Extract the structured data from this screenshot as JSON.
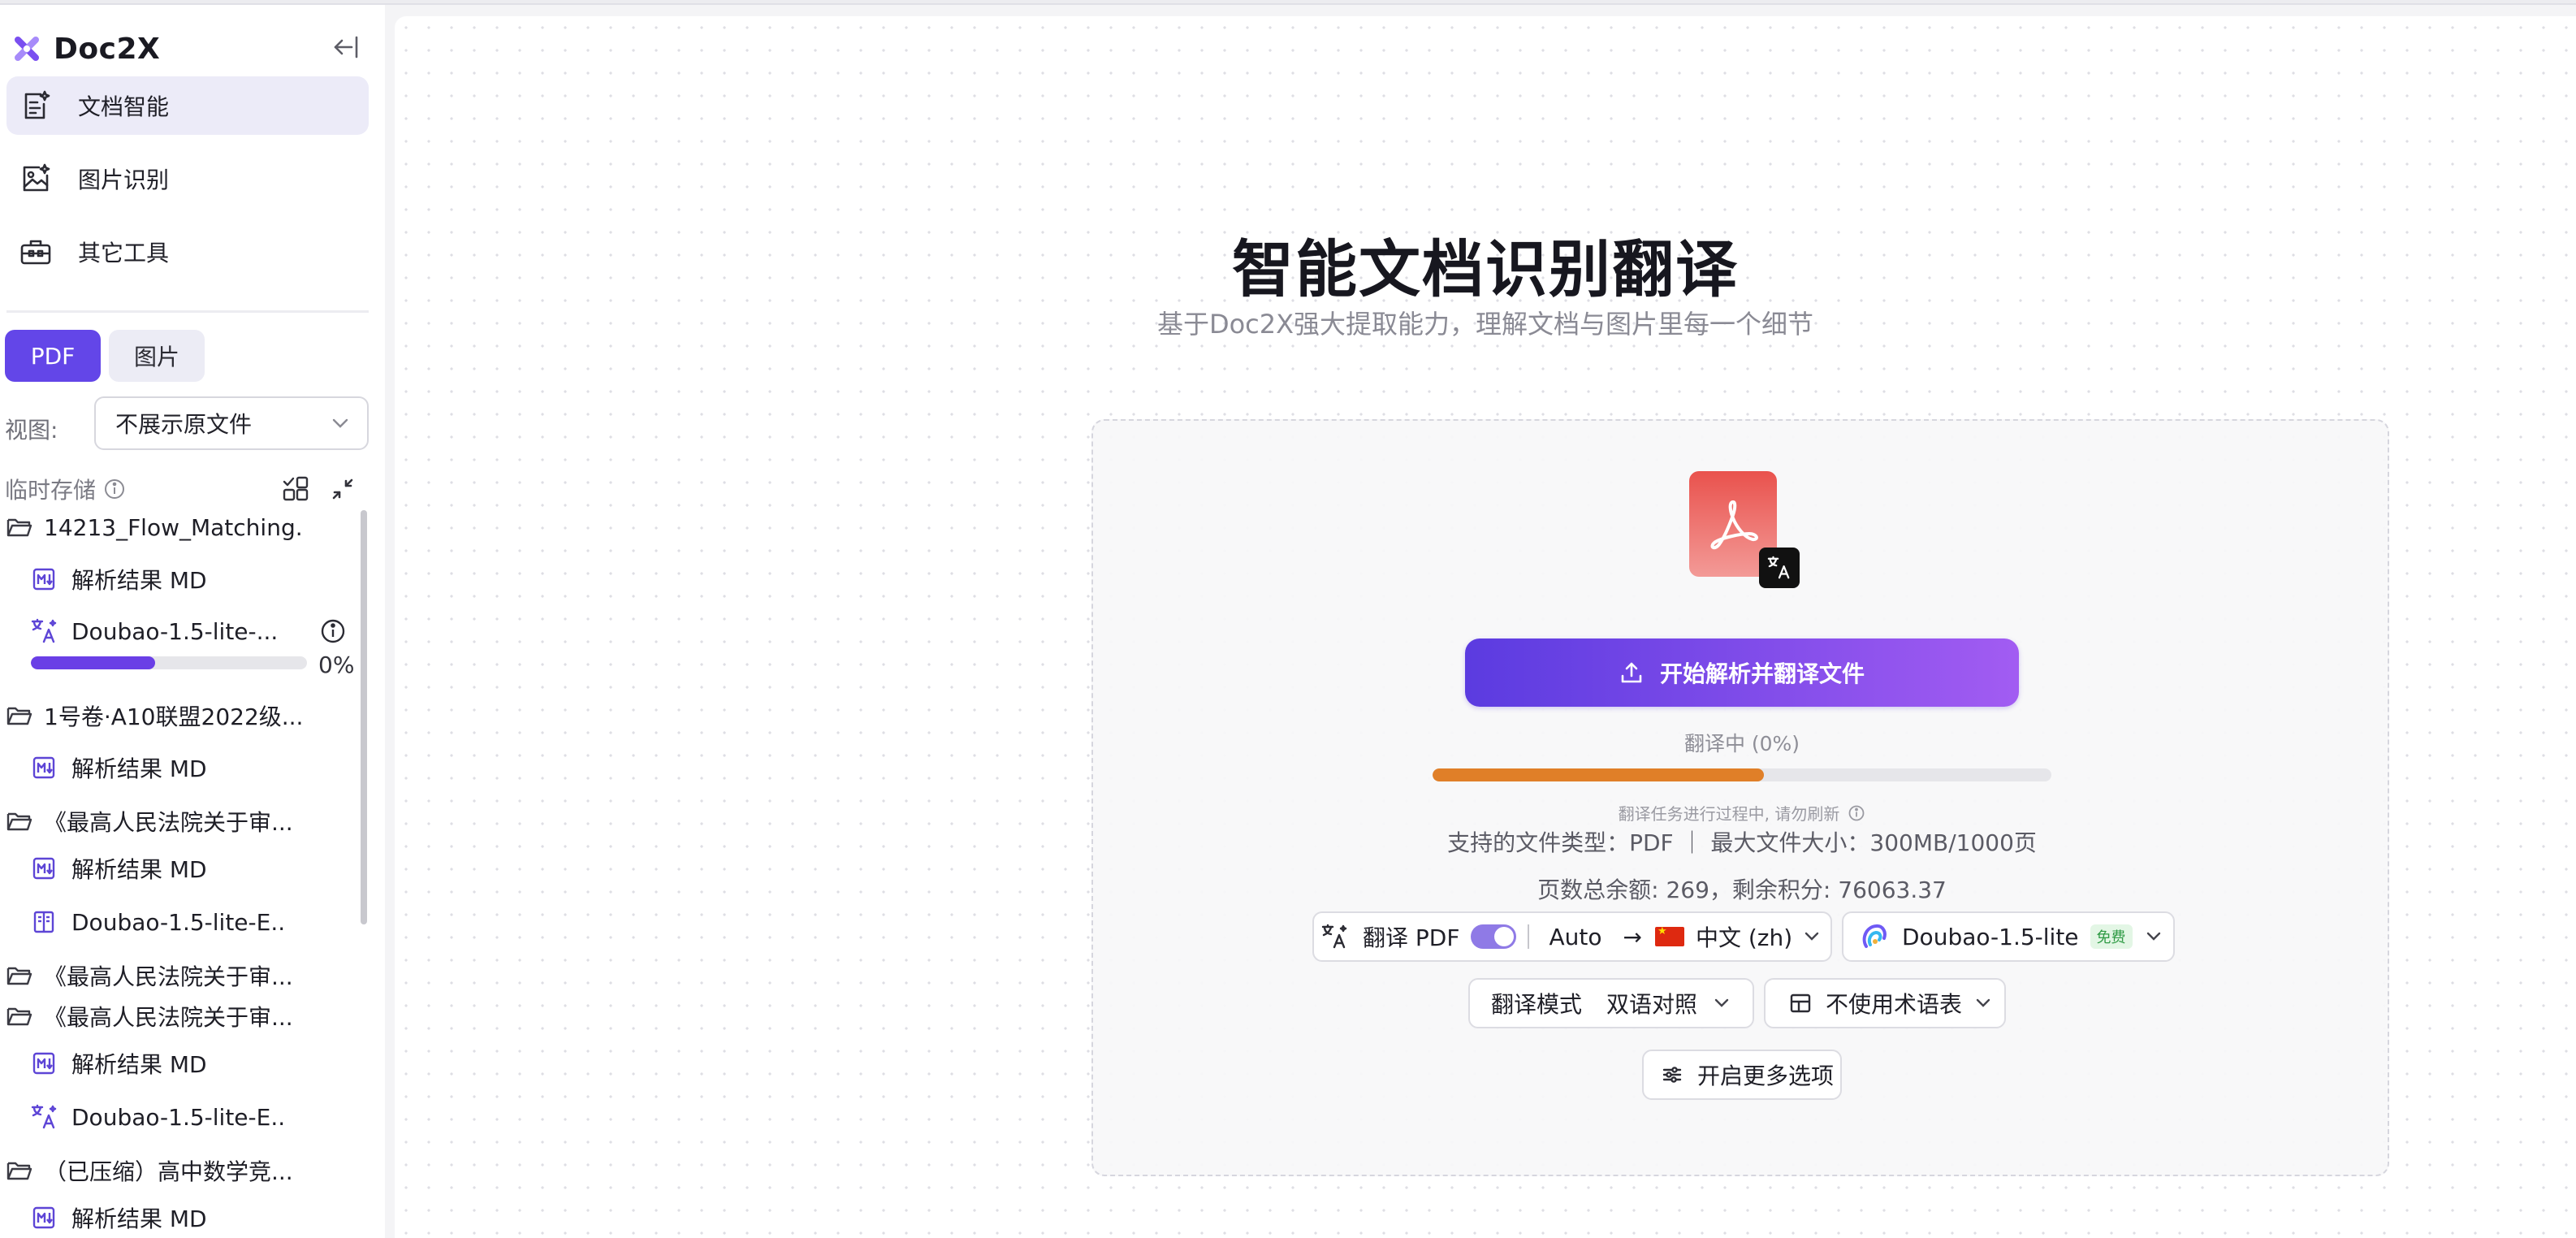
{
  "app": {
    "name": "Doc2X"
  },
  "nav": {
    "items": [
      {
        "label": "文档智能",
        "active": true
      },
      {
        "label": "图片识别",
        "active": false
      },
      {
        "label": "其它工具",
        "active": false
      }
    ]
  },
  "mode_tabs": {
    "pdf": "PDF",
    "image": "图片"
  },
  "view": {
    "label": "视图:",
    "selected": "不展示原文件"
  },
  "storage": {
    "label": "临时存储"
  },
  "tree": {
    "r0": "14213_Flow_Matching...",
    "r1": "解析结果 MD",
    "r2": "Doubao-1.5-lite-...",
    "r2_progress_pct": 0.45,
    "r2_pct_text": "0%",
    "r3": "1号卷·A10联盟2022级...",
    "r4": "解析结果 MD",
    "r5": "《最高人民法院关于审...",
    "r6": "解析结果 MD",
    "r7": "Doubao-1.5-lite-E...",
    "r8": "《最高人民法院关于审...",
    "r9": "《最高人民法院关于审...",
    "r10": "解析结果 MD",
    "r11": "Doubao-1.5-lite-E...",
    "r12": "（已压缩）高中数学竞...",
    "r13": "解析结果 MD"
  },
  "hero": {
    "title": "智能文档识别翻译",
    "subtitle": "基于Doc2X强大提取能力，理解文档与图片里每一个细节"
  },
  "upload": {
    "start_label": "开始解析并翻译文件",
    "status": "翻译中 (0%)",
    "progress_pct": 0.535,
    "hint": "翻译任务进行过程中, 请勿刷新",
    "support": "支持的文件类型：PDF ｜ 最大文件大小：300MB/1000页",
    "quota": "页数总余额: 269，剩余积分: 76063.37"
  },
  "options": {
    "translate_label": "翻译 PDF",
    "translate_enabled": true,
    "source_lang": "Auto",
    "arrow": "→",
    "target_lang": "中文 (zh)",
    "model": "Doubao-1.5-lite",
    "model_badge": "免费",
    "mode_label": "翻译模式",
    "mode_value": "双语对照",
    "glossary": "不使用术语表",
    "more": "开启更多选项"
  },
  "colors": {
    "accent": "#6346e8",
    "progress_orange": "#e07f28",
    "progress_purple": "#6a3fe6"
  },
  "icons": {
    "brand": "doc2x-logo-icon",
    "collapse": "collapse-left-icon",
    "nav": [
      "document-ai-icon",
      "image-recognize-icon",
      "toolbox-icon"
    ],
    "folder": "folder-open-icon",
    "markdown": "markdown-icon",
    "translate": "translate-icon",
    "bilingual": "bilingual-book-icon",
    "upload": "upload-icon",
    "table": "table-icon",
    "sliders": "sliders-icon"
  }
}
